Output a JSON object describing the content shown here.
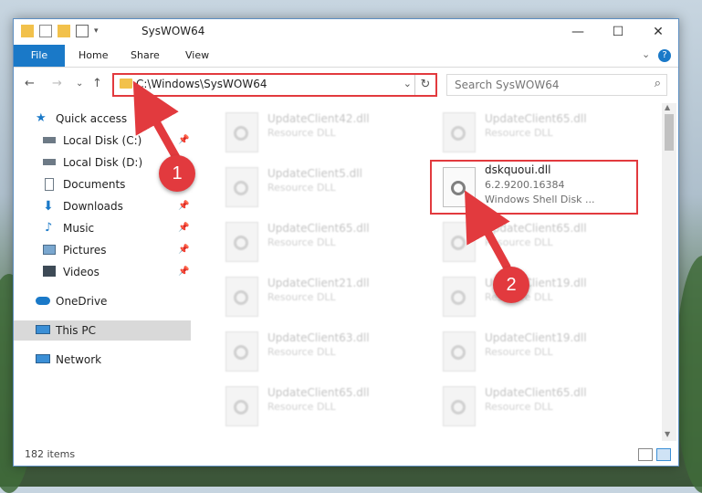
{
  "window": {
    "title": "SysWOW64",
    "controls": {
      "minimize": "—",
      "maximize": "☐",
      "close": "✕"
    }
  },
  "ribbon": {
    "tabs": [
      "File",
      "Home",
      "Share",
      "View"
    ],
    "expand": "⌄",
    "help": "?"
  },
  "nav": {
    "back": "←",
    "forward": "→",
    "recent": "⌄",
    "up": "↑",
    "address": "C:\\Windows\\SysWOW64",
    "address_dropdown": "⌄",
    "refresh": "↻",
    "search_placeholder": "Search SysWOW64",
    "search_icon": "⌕"
  },
  "sidebar": {
    "items": [
      {
        "label": "Quick access",
        "icon": "star-icon"
      },
      {
        "label": "Local Disk (C:)",
        "icon": "drive-icon",
        "pinned": true
      },
      {
        "label": "Local Disk (D:)",
        "icon": "drive-icon"
      },
      {
        "label": "Documents",
        "icon": "documents-icon",
        "pinned": true
      },
      {
        "label": "Downloads",
        "icon": "download-icon",
        "pinned": true
      },
      {
        "label": "Music",
        "icon": "music-icon",
        "pinned": true
      },
      {
        "label": "Pictures",
        "icon": "pictures-icon",
        "pinned": true
      },
      {
        "label": "Videos",
        "icon": "videos-icon",
        "pinned": true
      },
      {
        "label": "OneDrive",
        "icon": "cloud-icon"
      },
      {
        "label": "This PC",
        "icon": "pc-icon",
        "selected": true
      },
      {
        "label": "Network",
        "icon": "network-icon"
      }
    ],
    "pin_glyph": "📌"
  },
  "files": {
    "left": [
      {
        "name": "UpdateClient42.dll",
        "type": "Resource DLL"
      },
      {
        "name": "UpdateClient5.dll",
        "type": "Resource DLL"
      },
      {
        "name": "UpdateClient65.dll",
        "type": "Resource DLL"
      },
      {
        "name": "UpdateClient21.dll",
        "type": "Resource DLL"
      },
      {
        "name": "UpdateClient63.dll",
        "type": "Resource DLL"
      },
      {
        "name": "UpdateClient65.dll",
        "type": "Resource DLL"
      }
    ],
    "right": [
      {
        "name": "UpdateClient65.dll",
        "type": "Resource DLL"
      },
      {
        "name": "dskquoui.dll",
        "version": "6.2.9200.16384",
        "type": "Windows Shell Disk ..."
      },
      {
        "name": "UpdateClient65.dll",
        "type": "Resource DLL"
      },
      {
        "name": "UpdateClient19.dll",
        "type": "Resource DLL"
      },
      {
        "name": "UpdateClient19.dll",
        "type": "Resource DLL"
      },
      {
        "name": "UpdateClient65.dll",
        "type": "Resource DLL"
      }
    ]
  },
  "status": {
    "item_count": "182 items"
  },
  "annotations": {
    "step1": "1",
    "step2": "2",
    "color": "#e23a3e"
  }
}
